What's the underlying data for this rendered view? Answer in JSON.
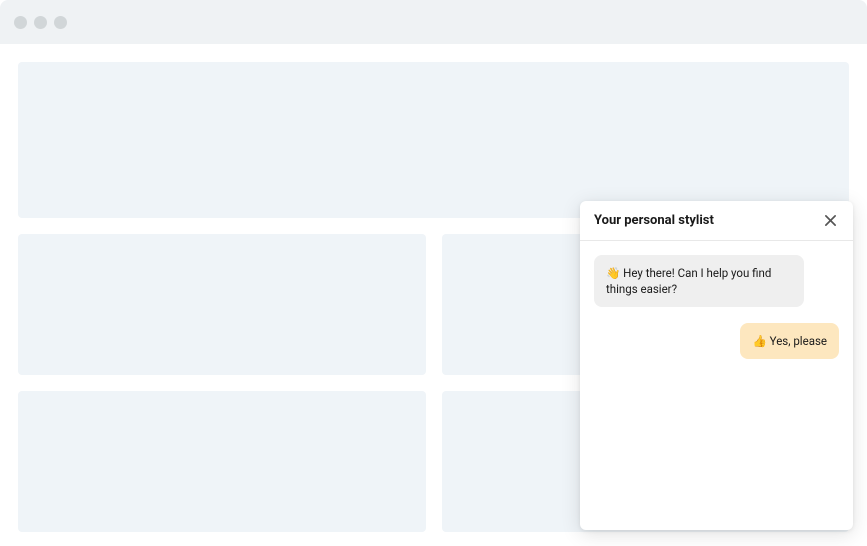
{
  "chat": {
    "title": "Your personal stylist",
    "messages": {
      "incoming_1": "👋  Hey there! Can I help you find things easier?",
      "outgoing_1": "👍 Yes, please"
    }
  }
}
